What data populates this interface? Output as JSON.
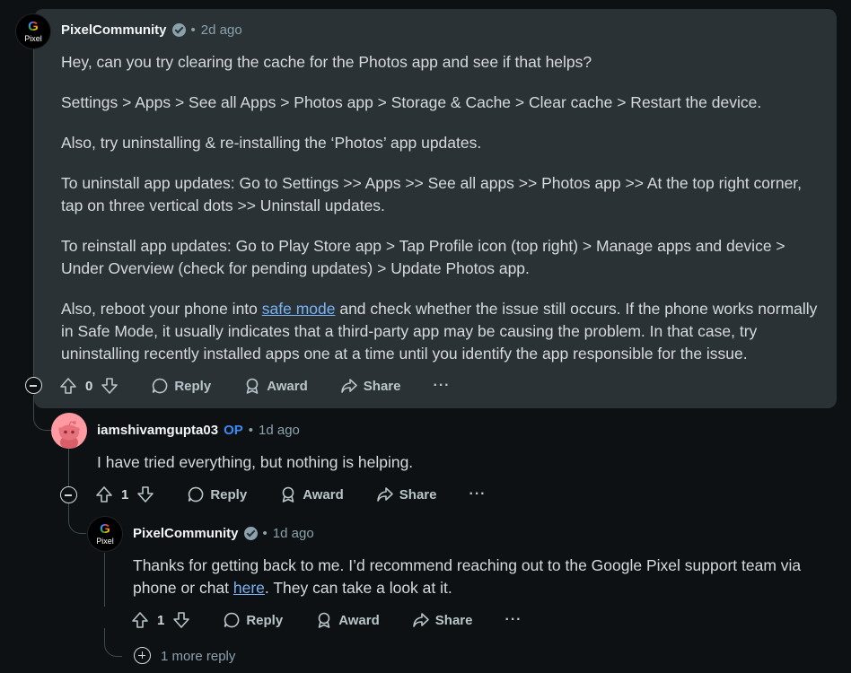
{
  "comment1": {
    "username": "PixelCommunity",
    "time": "2d ago",
    "avatar_letter": "G",
    "avatar_text": "Pixel",
    "paragraphs": [
      "Hey, can you try clearing the cache for the Photos app and see if that helps?",
      "Settings > Apps > See all Apps > Photos app > Storage & Cache > Clear cache > Restart the device.",
      "Also, try uninstalling & re-installing the ‘Photos’ app updates.",
      "To uninstall app updates: Go to Settings >> Apps >> See all apps >> Photos app >> At the top right corner, tap on three vertical dots >> Uninstall updates.",
      "To reinstall app updates: Go to Play Store app > Tap Profile icon (top right) > Manage apps and device > Under Overview (check for pending updates) > Update Photos app."
    ],
    "last_paragraph": {
      "before": "Also, reboot your phone into ",
      "link": "safe mode",
      "after": " and check whether the issue still occurs. If the phone works normally in Safe Mode, it usually indicates that a third-party app may be causing the problem. In that case, try uninstalling recently installed apps one at a time until you identify the app responsible for the issue."
    },
    "votes": "0",
    "reply_label": "Reply",
    "award_label": "Award",
    "share_label": "Share",
    "more_label": "···"
  },
  "comment2": {
    "username": "iamshivamgupta03",
    "op_badge": "OP",
    "time": "1d ago",
    "text": "I have tried everything, but nothing is helping.",
    "votes": "1",
    "reply_label": "Reply",
    "award_label": "Award",
    "share_label": "Share",
    "more_label": "···"
  },
  "comment3": {
    "username": "PixelCommunity",
    "time": "1d ago",
    "avatar_letter": "G",
    "avatar_text": "Pixel",
    "text_before": "Thanks for getting back to me. I’d recommend reaching out to the Google Pixel support team via phone or chat ",
    "link": "here",
    "text_after": ". They can take a look at it.",
    "votes": "1",
    "reply_label": "Reply",
    "award_label": "Award",
    "share_label": "Share",
    "more_label": "···"
  },
  "more_replies": "1 more reply",
  "dot_separator": "•"
}
